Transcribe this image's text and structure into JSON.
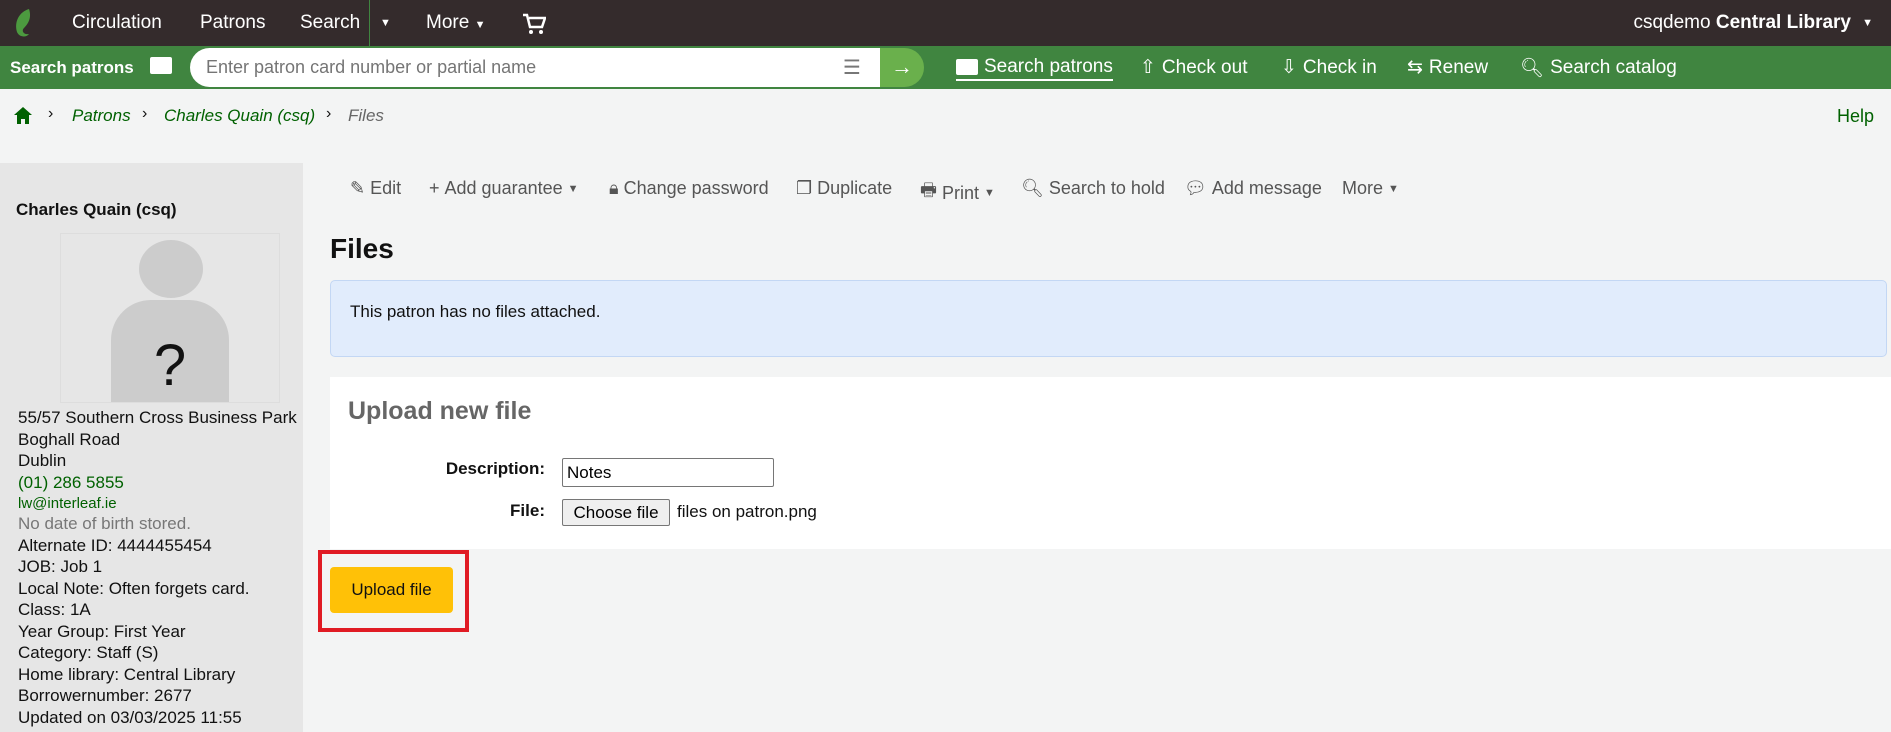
{
  "topnav": {
    "items": [
      "Circulation",
      "Patrons",
      "Search",
      "More"
    ],
    "user": "csqdemo",
    "library": "Central Library"
  },
  "searchbar": {
    "label": "Search patrons",
    "placeholder": "Enter patron card number or partial name",
    "links": [
      "Search patrons",
      "Check out",
      "Check in",
      "Renew",
      "Search catalog"
    ]
  },
  "breadcrumb": [
    "Patrons",
    "Charles Quain (csq)",
    "Files"
  ],
  "help": "Help",
  "patron": {
    "name": "Charles Quain (csq)",
    "address": [
      "55/57 Southern Cross Business Park",
      "Boghall Road",
      "Dublin"
    ],
    "phone": "(01) 286 5855",
    "email": "lw@interleaf.ie",
    "dob": "No date of birth stored.",
    "details": [
      "Alternate ID: 4444455454",
      "JOB: Job 1",
      "Local Note: Often forgets card.",
      "Class: 1A",
      "Year Group: First Year",
      "Category: Staff (S)",
      "Home library: Central Library",
      "Borrowernumber: 2677",
      "Updated on 03/03/2025 11:55"
    ]
  },
  "toolbar": [
    "Edit",
    "Add guarantee",
    "Change password",
    "Duplicate",
    "Print",
    "Search to hold",
    "Add message",
    "More"
  ],
  "page": {
    "title": "Files",
    "info": "This patron has no files attached.",
    "upload": {
      "heading": "Upload new file",
      "desc_label": "Description:",
      "desc_value": "Notes",
      "file_label": "File:",
      "choose": "Choose file",
      "filename": "files on patron.png",
      "submit": "Upload file"
    }
  },
  "colors": {
    "topnav": "#342b2c",
    "green": "#408540",
    "accent": "#ffc107",
    "highlight": "#e01b24"
  }
}
